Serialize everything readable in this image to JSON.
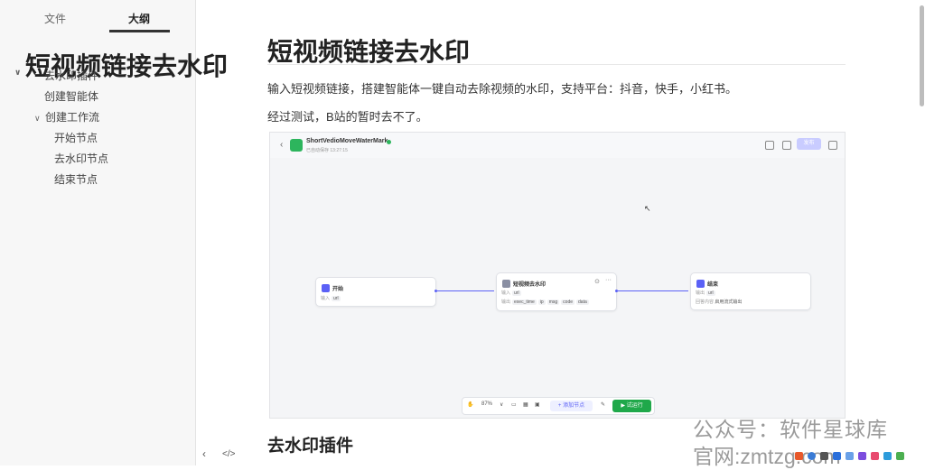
{
  "sidebar": {
    "tabs": [
      {
        "label": "文件",
        "active": false
      },
      {
        "label": "大纲",
        "active": true
      }
    ],
    "outline": [
      {
        "label": "短视频链接去水印",
        "level": 1,
        "expanded": true
      },
      {
        "label": "去水印插件",
        "level": 2
      },
      {
        "label": "创建智能体",
        "level": 2
      },
      {
        "label": "创建工作流",
        "level": 2,
        "expanded": true
      },
      {
        "label": "开始节点",
        "level": 3
      },
      {
        "label": "去水印节点",
        "level": 3
      },
      {
        "label": "结束节点",
        "level": 3
      }
    ],
    "bottom": {
      "collapse_label": "‹",
      "source_label": "</>"
    }
  },
  "document": {
    "title": "短视频链接去水印",
    "paragraphs": [
      "输入短视频链接，搭建智能体一键自动去除视频的水印，支持平台：抖音，快手，小红书。",
      "经过测试，B站的暂时去不了。"
    ],
    "section_heading": "去水印插件"
  },
  "embedded_screenshot": {
    "app_title": "ShortVedioMoveWaterMark",
    "app_subtitle": "已自动保存 13:27:15",
    "publish_label": "发布",
    "nodes": {
      "start": {
        "title": "开始",
        "row_label": "输入",
        "vars": [
          "url"
        ]
      },
      "watermark": {
        "title": "短视频去水印",
        "row1_label": "输入",
        "row1_vars": [
          "url"
        ],
        "row2_label": "输出",
        "row2_vars": [
          "exec_time",
          "ip",
          "msg",
          "code",
          "data"
        ]
      },
      "end": {
        "title": "结束",
        "row1_label": "输出",
        "row1_vars": [
          "url"
        ],
        "row2_label": "回答内容",
        "row2_value": "启用流式输出"
      }
    },
    "toolbar": {
      "zoom": "87%",
      "add_node": "+ 添加节点",
      "run": "▶ 试运行"
    }
  },
  "watermark": {
    "line1": "公众号：软件星球库",
    "line2": "官网:zmtzg.com"
  },
  "colors": {
    "accent": "#5b61f6",
    "run_green": "#1fa84a",
    "sidebar_bg": "#f7f7f7"
  }
}
